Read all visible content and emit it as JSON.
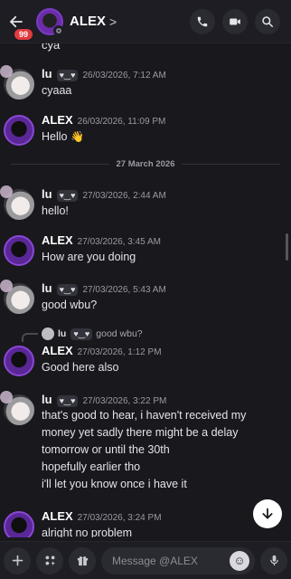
{
  "header": {
    "unread_badge": "99",
    "contact_name": "ALEX",
    "chevron": ">"
  },
  "cutoff_text": "cya",
  "messages": [
    {
      "author": "lu",
      "tag": "♥‿♥",
      "time": "26/03/2026, 7:12 AM",
      "text": "cyaaa"
    },
    {
      "author": "ALEX",
      "time": "26/03/2026, 11:09 PM",
      "text": "Hello",
      "emoji": "👋"
    },
    {
      "author": "lu",
      "tag": "♥‿♥",
      "time": "27/03/2026, 2:44 AM",
      "text": "hello!"
    },
    {
      "author": "ALEX",
      "time": "27/03/2026, 3:45 AM",
      "text": "How are you doing"
    },
    {
      "author": "lu",
      "tag": "♥‿♥",
      "time": "27/03/2026, 5:43 AM",
      "text": "good wbu?"
    },
    {
      "author": "ALEX",
      "time": "27/03/2026, 1:12 PM",
      "text": "Good here also",
      "reply": {
        "author": "lu",
        "tag": "♥‿♥",
        "text": "good wbu?"
      }
    },
    {
      "author": "lu",
      "tag": "♥‿♥",
      "time": "27/03/2026, 3:22 PM",
      "lines": [
        "that's good to hear, i haven't received my",
        "money yet sadly there might be a delay",
        "tomorrow or until the 30th",
        "hopefully earlier tho",
        "i'll let you know once i have it"
      ]
    },
    {
      "author": "ALEX",
      "time": "27/03/2026, 3:24 PM",
      "text": "alright no problem"
    }
  ],
  "date_divider": "27 March 2026",
  "composer": {
    "placeholder": "Message @ALEX"
  },
  "icons": [
    "back-arrow-icon",
    "phone-icon",
    "video-camera-icon",
    "search-icon",
    "plus-icon",
    "apps-icon",
    "gift-icon",
    "emoji-icon",
    "microphone-icon",
    "arrow-down-icon"
  ],
  "colors": {
    "badge": "#e23a3d",
    "alex_ring": "#8b47d6",
    "background": "#18181d"
  }
}
